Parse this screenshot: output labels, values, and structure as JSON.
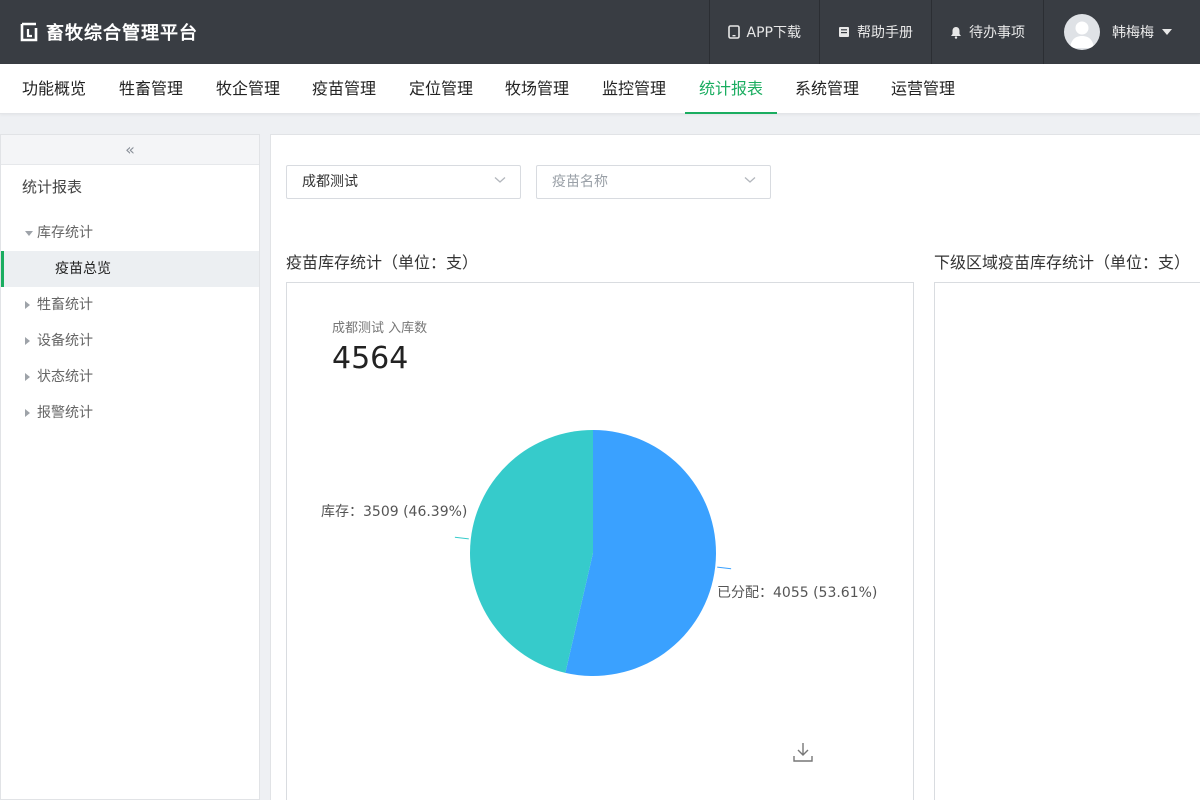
{
  "app": {
    "title": "畜牧综合管理平台"
  },
  "topbar": {
    "app_download": "APP下载",
    "help": "帮助手册",
    "todo": "待办事项",
    "user_name": "韩梅梅"
  },
  "nav": {
    "items": [
      "功能概览",
      "牲畜管理",
      "牧企管理",
      "疫苗管理",
      "定位管理",
      "牧场管理",
      "监控管理",
      "统计报表",
      "系统管理",
      "运营管理"
    ],
    "active": "统计报表"
  },
  "sidebar": {
    "collapse_icon": "«",
    "title": "统计报表",
    "groups": [
      {
        "label": "库存统计",
        "expanded": true,
        "children": [
          "疫苗总览"
        ]
      },
      {
        "label": "牲畜统计",
        "expanded": false
      },
      {
        "label": "设备统计",
        "expanded": false
      },
      {
        "label": "状态统计",
        "expanded": false
      },
      {
        "label": "报警统计",
        "expanded": false
      }
    ],
    "active_child": "疫苗总览"
  },
  "filters": {
    "region": {
      "value": "成都测试"
    },
    "vaccine": {
      "placeholder": "疫苗名称"
    }
  },
  "panels": {
    "left_title": "疫苗库存统计（单位：支）",
    "right_title": "下级区域疫苗库存统计（单位：支）"
  },
  "stat": {
    "label": "成都测试 入库数",
    "value": "4564"
  },
  "colors": {
    "topbar": "#393d43",
    "accent": "#1aad60",
    "slice_allocated": "#3aa1ff",
    "slice_stock": "#36cbcb"
  },
  "chart_data": {
    "type": "pie",
    "slices": [
      {
        "name": "已分配",
        "value": 4055,
        "percent": 53.61,
        "label": "已分配：4055 (53.61%)"
      },
      {
        "name": "库存",
        "value": 3509,
        "percent": 46.39,
        "label": "库存：3509 (46.39%)"
      }
    ]
  }
}
